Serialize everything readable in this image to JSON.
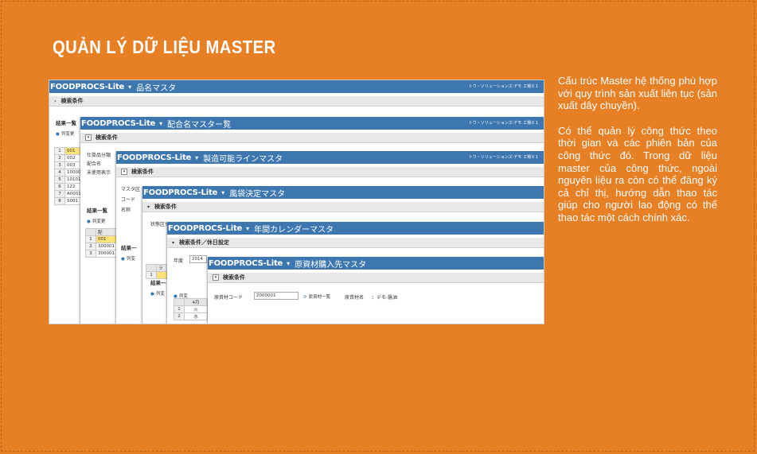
{
  "page": {
    "title": "QUẢN LÝ DỮ LIỆU MASTER",
    "paragraphs": [
      "Cấu trúc Master hệ thống phù hợp với quy trình sản xuất liên tục (sản xuất dây chuyền).",
      "Có thể quản lý công thức theo thời gian và các phiên bản của công thức đó. Trong dữ liệu master của công thức, ngoài nguyên liệu ra còn có thể đăng ký cả chỉ thị, hướng dẫn thao tác giúp cho người lao động có thể thao tác một cách chính xác."
    ],
    "colors": {
      "background": "#e77f24",
      "titlebar": "#3e77b0",
      "highlight": "#ffe27a"
    }
  },
  "screenshot": {
    "brand": "FOODPROCS-Lite",
    "separator": "▾",
    "windows": [
      {
        "title": "品名マスタ",
        "company": "トウ・ソリューションズ-デモ 工場０１",
        "cond_label": "検索条件",
        "result_label": "結果一覧",
        "check_label": "列変更",
        "rows": [
          "1",
          "2",
          "3",
          "4",
          "5",
          "6",
          "7",
          "8"
        ],
        "codes": [
          "001",
          "002",
          "003",
          "10000",
          "10101",
          "122",
          "A0001",
          "S001"
        ]
      },
      {
        "title": "配合名マスター覧",
        "company": "トウ・ソリューションズ-デモ 工場０１",
        "cond_label": "検索条件",
        "fields": [
          "仕掛品分類",
          "配合名",
          "未使用表示"
        ],
        "result_label": "結果一覧",
        "check_label": "列変更",
        "col_header": "配",
        "rows": [
          "1",
          "2",
          "3"
        ],
        "codes": [
          "001",
          "300001",
          "300001"
        ]
      },
      {
        "title": "製造可能ラインマスタ",
        "company": "トウ・ソリューションズ-デモ 工場０１",
        "cond_label": "検索条件",
        "fields": [
          "マスタ区",
          "コード",
          "名称"
        ],
        "result_label": "結果一",
        "check_label": "列変",
        "rows": [
          "1",
          "2"
        ]
      },
      {
        "title": "風袋決定マスタ",
        "cond_label": "検索条件",
        "fields": [
          "状態区分"
        ],
        "result_label": "結果一",
        "check_label": "列変",
        "col_header": "ラ",
        "rows": [
          "1",
          "2"
        ]
      },
      {
        "title": "年間カレンダーマスタ",
        "cond_label": "検索条件／休日設定",
        "year_label": "年度",
        "year_value": "2014",
        "check_label": "列変",
        "month_header": "4月",
        "days": [
          "火",
          "水"
        ],
        "rows": [
          "1",
          "2"
        ]
      },
      {
        "title": "原資材購入先マスタ",
        "cond_label": "検索条件",
        "code_label": "原資材コード",
        "code_value": "2000001",
        "list_link": "原資材一覧",
        "name_label": "原資材名",
        "name_value": "：デモ-醤油"
      }
    ]
  }
}
